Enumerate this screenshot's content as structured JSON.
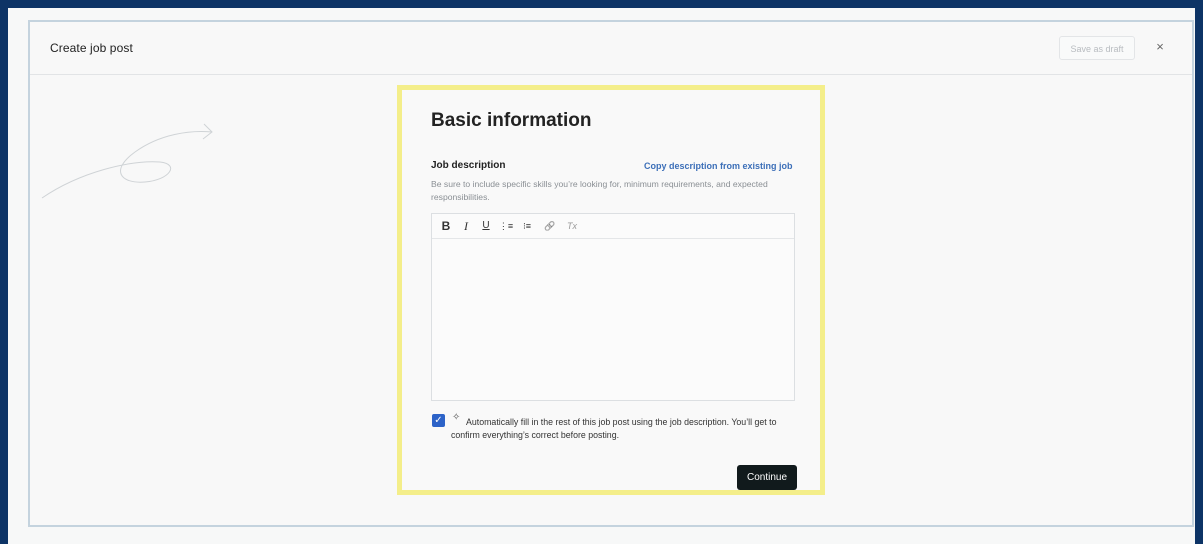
{
  "header": {
    "title": "Create job post",
    "save_draft_label": "Save as draft",
    "close_label": "×"
  },
  "card": {
    "heading": "Basic information",
    "field_label": "Job description",
    "copy_link": "Copy description from existing job",
    "helper_text": "Be sure to include specific skills you’re looking for, minimum requirements, and expected responsibilities.",
    "editor_value": "",
    "toolbar": {
      "bold": "B",
      "italic": "I",
      "underline": "U",
      "bullet_list": "⋮≡",
      "numbered_list": "⁝≡",
      "link": "🔗",
      "clear_format": "Tx"
    },
    "autofill_checked": true,
    "autofill_text": "Automatically fill in the rest of this job post using the job description. You’ll get to confirm everything’s correct before posting.",
    "continue_label": "Continue"
  },
  "colors": {
    "accent_blue": "#2d63c8",
    "link_blue": "#3c6fb8",
    "highlight_yellow": "#f4ee8a",
    "continue_bg": "#111a1c"
  }
}
